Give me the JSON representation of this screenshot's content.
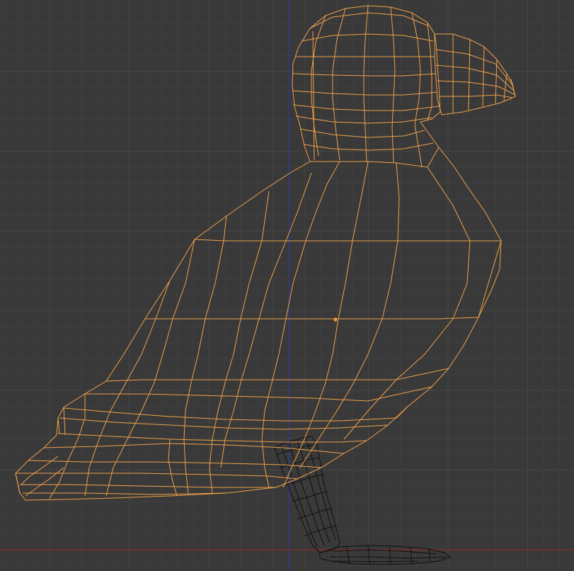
{
  "viewport": {
    "mode": "wireframe",
    "view": "side-orthographic",
    "selected_object": "puffin-body",
    "colors": {
      "background": "#393939",
      "grid_minor": "#404040",
      "grid_major": "#464646",
      "selected_wire": "#f0a04a",
      "unselected_wire": "#101010",
      "axis_z": "#2a3a9a",
      "axis_y": "#8a2a2a",
      "origin_dot": "#f0a04a"
    }
  }
}
